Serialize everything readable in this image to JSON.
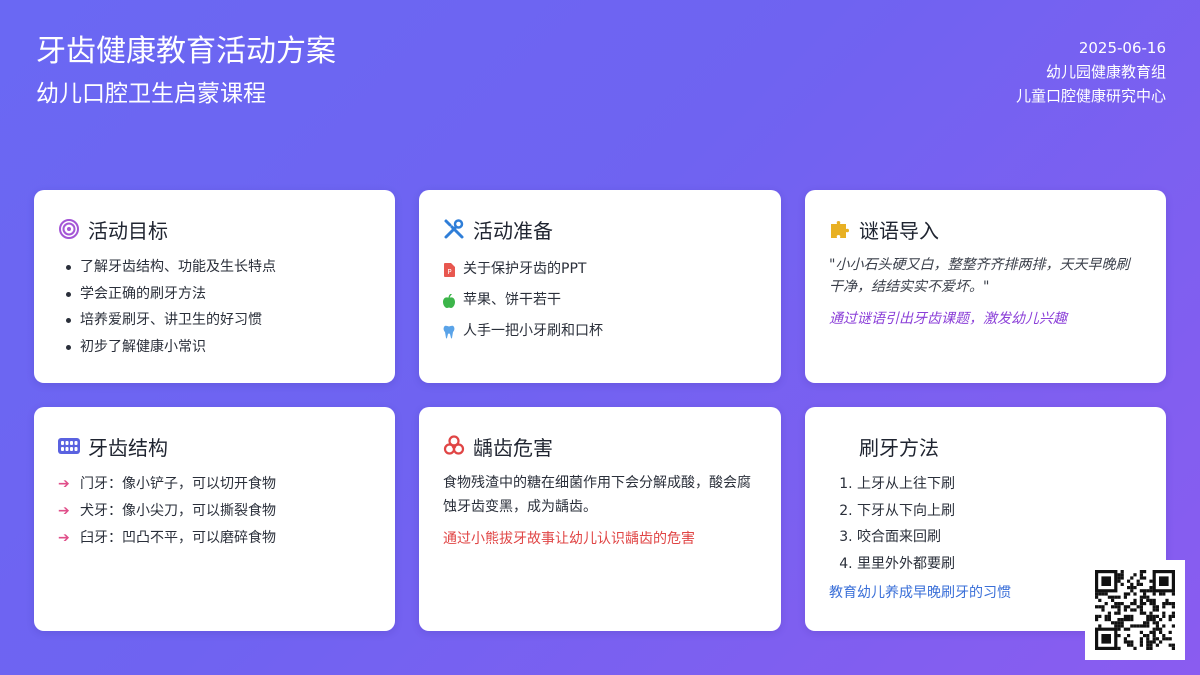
{
  "header": {
    "title": "牙齿健康教育活动方案",
    "subtitle": "幼儿口腔卫生启蒙课程",
    "date": "2025-06-16",
    "org1": "幼儿园健康教育组",
    "org2": "儿童口腔健康研究中心"
  },
  "goals": {
    "title": "活动目标",
    "icon": "target-icon",
    "items": [
      "了解牙齿结构、功能及生长特点",
      "学会正确的刷牙方法",
      "培养爱刷牙、讲卫生的好习惯",
      "初步了解健康小常识"
    ]
  },
  "prep": {
    "title": "活动准备",
    "icon": "tools-icon",
    "items": [
      {
        "text": "关于保护牙齿的PPT",
        "icon": "ppt-file-icon"
      },
      {
        "text": "苹果、饼干若干",
        "icon": "apple-icon"
      },
      {
        "text": "人手一把小牙刷和口杯",
        "icon": "tooth-icon"
      }
    ]
  },
  "riddle": {
    "title": "谜语导入",
    "icon": "puzzle-icon",
    "text": "\"小小石头硬又白，整整齐齐排两排，天天早晚刷干净，结结实实不爱坏。\"",
    "note": "通过谜语引出牙齿课题，激发幼儿兴趣"
  },
  "structure": {
    "title": "牙齿结构",
    "icon": "teeth-icon",
    "items": [
      "门牙：像小铲子，可以切开食物",
      "犬牙：像小尖刀，可以撕裂食物",
      "臼牙：凹凸不平，可以磨碎食物"
    ]
  },
  "decay": {
    "title": "龋齿危害",
    "icon": "biohazard-icon",
    "text": "食物残渣中的糖在细菌作用下会分解成酸，酸会腐蚀牙齿变黑，成为龋齿。",
    "note": "通过小熊拔牙故事让幼儿认识龋齿的危害"
  },
  "brushing": {
    "title": "刷牙方法",
    "steps": [
      "上牙从上往下刷",
      "下牙从下向上刷",
      "咬合面来回刷",
      "里里外外都要刷"
    ],
    "note": "教育幼儿养成早晚刷牙的习惯"
  },
  "qr": {
    "icon": "qr-code-icon"
  }
}
